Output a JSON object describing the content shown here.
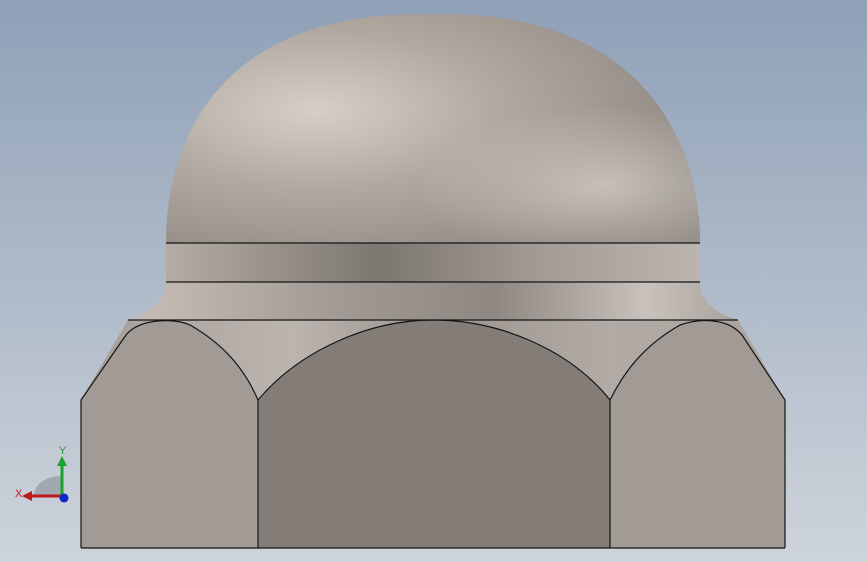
{
  "viewport": {
    "background_top": "#8fa0b7",
    "background_bottom": "#ced4db",
    "model_color": "#a8a09a",
    "edge_color": "#141414"
  },
  "triad": {
    "x_label": "X",
    "y_label": "Y",
    "x_color": "#c0181c",
    "y_color": "#1aa12e",
    "z_color": "#1028c8"
  }
}
